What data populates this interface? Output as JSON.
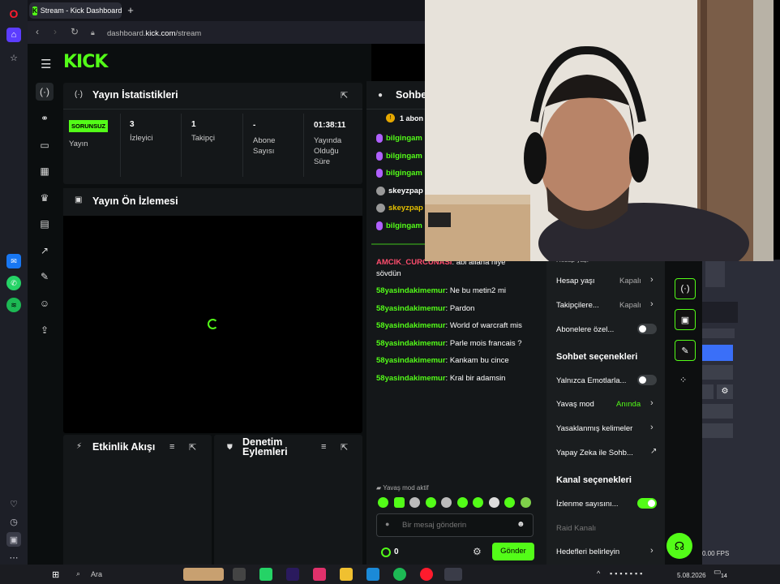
{
  "browser": {
    "tab_title": "Stream - Kick Dashboard",
    "url_prefix": "dashboard.",
    "url_host": "kick.com",
    "url_path": "/stream"
  },
  "kick": {
    "logo": "KICK"
  },
  "stats": {
    "title": "Yayın İstatistikleri",
    "status_badge": "SORUNSUZ",
    "status_label": "Yayın",
    "viewers_value": "3",
    "viewers_label": "İzleyici",
    "followers_value": "1",
    "followers_label": "Takipçi",
    "subs_value": "-",
    "subs_label": "Abone Sayısı",
    "uptime_value": "01:38:11",
    "uptime_label": "Yayında Olduğu Süre"
  },
  "preview": {
    "title": "Yayın Ön İzlemesi"
  },
  "activity": {
    "title": "Etkinlik Akışı"
  },
  "moderation": {
    "title": "Denetim Eylemleri"
  },
  "chat": {
    "title": "Sohbe",
    "subs_info": "1 abon",
    "list": [
      {
        "name": "bilgingam",
        "color": "#53fc18"
      },
      {
        "name": "bilgingam",
        "color": "#53fc18"
      },
      {
        "name": "bilgingam",
        "color": "#53fc18"
      },
      {
        "name": "skeyzpap",
        "color": "#ffffff"
      },
      {
        "name": "skeyzpap",
        "color": "#e6c000"
      },
      {
        "name": "bilgingam",
        "color": "#53fc18"
      }
    ],
    "messages": [
      {
        "user": "AMCIK_CURCUNASI",
        "text": ": abi allaha niye",
        "cont": "sövdün"
      },
      {
        "user": "58yasindakimemur",
        "text": ": Ne bu metin2 mi"
      },
      {
        "user": "58yasindakimemur",
        "text": ": Pardon"
      },
      {
        "user": "58yasindakimemur",
        "text": ": World of warcraft mis"
      },
      {
        "user": "58yasindakimemur",
        "text": ": Parle mois francais ?"
      },
      {
        "user": "58yasindakimemur",
        "text": ": Kankam bu cince"
      },
      {
        "user": "58yasindakimemur",
        "text": ": Kral bir adamsin"
      }
    ],
    "slow_mode_notice": "Yavaş mod aktif",
    "input_placeholder": "Bir mesaj gönderin",
    "points": "0",
    "send_label": "Gönder"
  },
  "settings_menu": {
    "cut_item": "Hesap yaşı",
    "account_age": "Hesap yaşı",
    "account_age_value": "Kapalı",
    "followers": "Takipçilere...",
    "followers_value": "Kapalı",
    "subs_only": "Abonelere özel...",
    "chat_options_header": "Sohbet seçenekleri",
    "emotes_only": "Yalnızca Emotlarla...",
    "slow_mode": "Yavaş mod",
    "slow_mode_value": "Anında",
    "banned_words": "Yasaklanmış kelimeler",
    "ai_chat": "Yapay Zeka ile Sohb...",
    "channel_options_header": "Kanal seçenekleri",
    "view_count": "İzlenme sayısını...",
    "raid_channel": "Raid Kanalı",
    "set_goals": "Hedefleri belirleyin"
  },
  "obs": {
    "fps": "0.00 FPS"
  },
  "taskbar": {
    "search": "Ara",
    "date": "5.08.2026",
    "notif_count": "14"
  },
  "colors": {
    "kick_green": "#53fc18",
    "panel": "#141719",
    "background": "#0b0e0f"
  }
}
